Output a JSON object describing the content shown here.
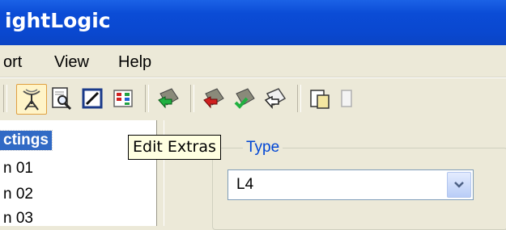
{
  "window": {
    "title": "ightLogic"
  },
  "menubar": {
    "items": [
      "ort",
      "View",
      "Help"
    ]
  },
  "toolbar": {
    "buttons": [
      {
        "icon": "antenna-icon",
        "pressed": true
      },
      {
        "icon": "print-preview-icon",
        "pressed": false
      },
      {
        "icon": "edit-extras-icon",
        "pressed": false
      },
      {
        "icon": "color-grid-icon",
        "pressed": false
      },
      {
        "icon": "arrow-green-icon",
        "pressed": false
      },
      {
        "icon": "arrow-red-icon",
        "pressed": false
      },
      {
        "icon": "check-green-icon",
        "pressed": false
      },
      {
        "icon": "arrow-outline-icon",
        "pressed": false
      },
      {
        "icon": "paste-icon",
        "pressed": false
      }
    ]
  },
  "tree": {
    "items": [
      {
        "label": "ctings",
        "selected": true
      },
      {
        "label": "n 01",
        "selected": false
      },
      {
        "label": "n 02",
        "selected": false
      },
      {
        "label": "n 03",
        "selected": false
      }
    ]
  },
  "tooltip": {
    "text": "Edit Extras"
  },
  "type_group": {
    "legend": "Type",
    "combo_value": "L4"
  },
  "colors": {
    "titlebar": "#0a48d0",
    "selection": "#316ac5",
    "tooltip_bg": "#ffffe1",
    "legend": "#0046d5"
  }
}
